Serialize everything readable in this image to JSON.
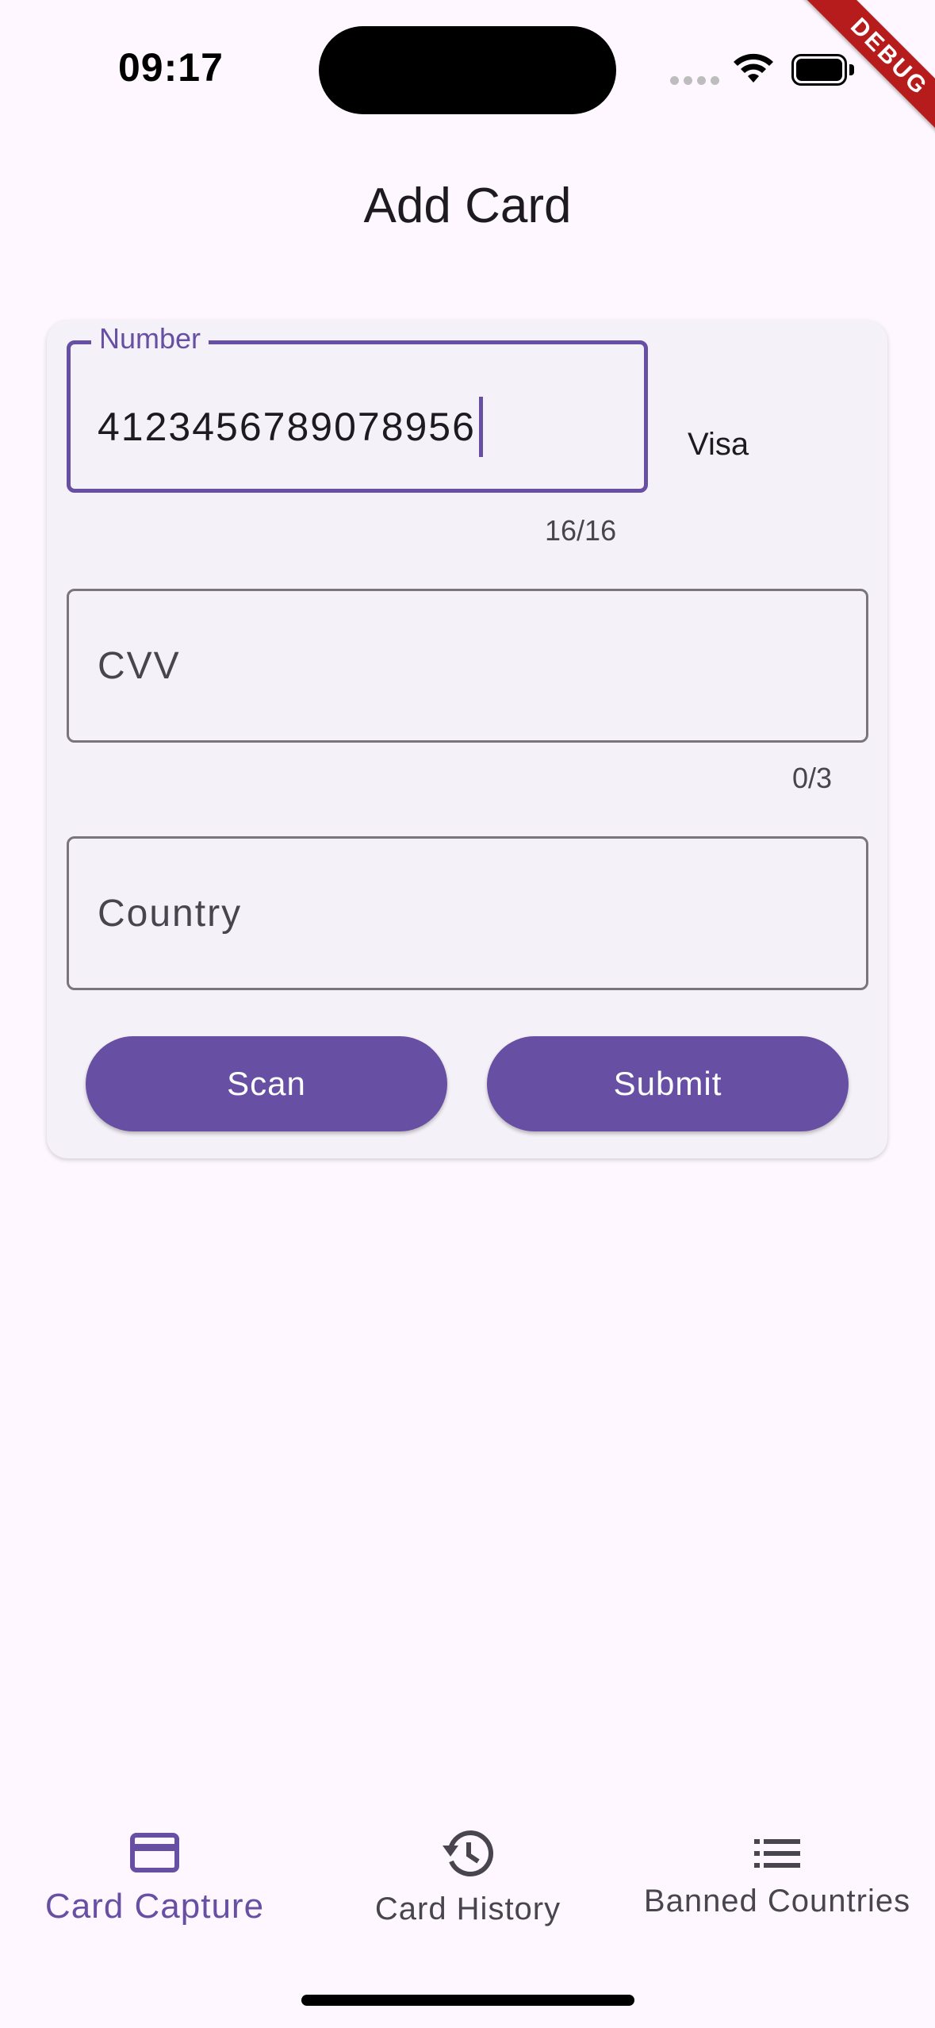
{
  "status_bar": {
    "time": "09:17",
    "icons": [
      "signal-dots-icon",
      "wifi-icon",
      "battery-icon"
    ],
    "debug_banner": "DEBUG"
  },
  "header": {
    "title": "Add Card"
  },
  "form": {
    "number": {
      "label": "Number",
      "value": "4123456789078956",
      "counter": "16/16",
      "brand": "Visa"
    },
    "cvv": {
      "placeholder": "CVV",
      "value": "",
      "counter": "0/3"
    },
    "country": {
      "placeholder": "Country",
      "value": ""
    },
    "scan_label": "Scan",
    "submit_label": "Submit"
  },
  "bottom_nav": {
    "items": [
      {
        "label": "Card Capture",
        "icon": "credit-card-icon",
        "active": true
      },
      {
        "label": "Card History",
        "icon": "history-icon",
        "active": false
      },
      {
        "label": "Banned Countries",
        "icon": "list-icon",
        "active": false
      }
    ]
  },
  "colors": {
    "accent": "#6750a4",
    "background": "#fef7ff",
    "card": "#f5f1f8",
    "debug": "#b71c1c"
  }
}
